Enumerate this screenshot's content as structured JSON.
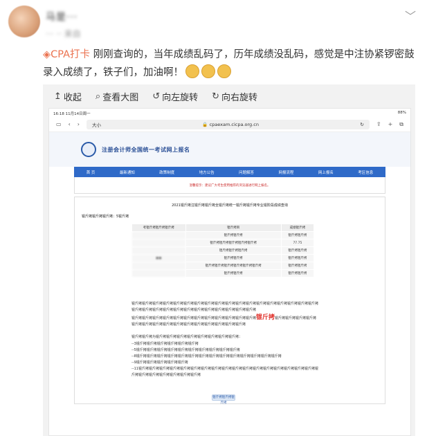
{
  "post": {
    "username": "马是···",
    "meta": "··· ·· 来自",
    "topic": "CPA打卡",
    "body": " 刚刚查询的，当年成绩乱码了，历年成绩没乱码，感觉是中注协紧锣密鼓录入成绩了，铁子们，加油啊！",
    "emoji_count": 3
  },
  "toolbar": {
    "collapse": "收起",
    "view_large": "查看大图",
    "rotate_left": "向左旋转",
    "rotate_right": "向右旋转"
  },
  "screenshot": {
    "status_time": "16:18  11月14日周一",
    "status_battery": "88%",
    "browser_tab": "大小",
    "url": "cpaexam.cicpa.org.cn",
    "site_title": "注册会计师全国统一考试网上报名",
    "nav": [
      "首 页",
      "最新通知",
      "政策制度",
      "地方公告",
      "问题解答",
      "网报流程",
      "网上报名",
      "考区信息"
    ],
    "notice": "温馨提示：建议广大考生使用推荐的浏览器进行网上报名。",
    "report_title": "2021锟斤拷注锟斤拷锟斤拷全锟斤拷统一锟斤拷锟斤拷专业锟阶段成绩查询",
    "report_name": "锟斤拷锟斤拷锟斤拷：5锟斤拷",
    "table_headers": [
      "考锟斤拷锟斤拷锟斤拷",
      "锟斤拷目",
      "成绩锟斤拷"
    ],
    "table_rows": [
      {
        "subject": "锟斤拷锟斤拷",
        "score": "锟斤拷锟斤拷"
      },
      {
        "subject": "锟斤拷锟斤拷锟斤拷锟斤拷锟斤拷",
        "score": "77.75"
      },
      {
        "subject": "锟斤拷锟斤拷锟斤拷",
        "score": "锟斤拷锟斤拷"
      },
      {
        "subject": "锟斤拷锟斤拷",
        "score": "锟斤拷锟斤拷"
      },
      {
        "subject": "锟斤拷锟斤拷锟斤拷锟斤拷锟斤拷锟斤拷",
        "score": "锟斤拷锟斤拷"
      },
      {
        "subject": "锟斤拷锟斤拷",
        "score": "锟斤拷锟斤拷"
      }
    ],
    "para1": "锟斤拷锟斤拷锟斤拷锟斤拷锟斤拷锟斤拷锟斤拷锟斤拷锟斤拷锟斤拷锟斤拷锟斤拷锟斤拷锟斤拷锟斤拷锟斤拷锟斤拷锟斤拷锟斤拷锟斤拷锟斤拷锟斤拷锟斤拷锟斤拷锟斤拷锟斤拷锟斤拷锟斤拷锟斤拷锟斤拷",
    "para2_a": "锟斤拷锟斤拷锟斤拷锟斤拷锟斤拷锟斤拷锟斤拷锟斤拷锟斤拷锟斤拷锟斤拷锟斤拷",
    "para2_red": "锟斤拷",
    "para2_b": "锟斤拷锟斤拷锟斤拷锟斤拷锟斤拷锟斤拷锟斤拷锟斤拷锟斤拷锟斤拷锟斤拷锟斤拷锟斤拷锟斤拷锟斤拷",
    "para3": "锟斤拷锟斤拷为锟斤拷锟斤拷锟斤拷锟斤拷锟斤拷锟斤拷锟斤拷锟斤拷：",
    "list": [
      "--3锟斤拷锟斤拷锟斤拷锟斤拷锟斤拷锟斤拷",
      "--5锟斤拷锟斤拷锟斤拷锟斤拷锟斤拷锟斤拷锟斤拷锟斤拷锟斤拷锟斤拷",
      "--8锟斤拷锟斤拷锟斤拷锟斤拷锟斤拷锟斤拷锟斤拷锟斤拷锟斤拷锟斤拷锟斤拷锟斤拷锟斤拷锟斤拷",
      "--9锟斤拷锟斤拷锟斤拷锟斤拷锟斤拷",
      "--11锟斤拷锟斤拷锟斤拷锟斤拷锟斤拷锟斤拷锟斤拷锟斤拷锟斤拷锟斤拷锟斤拷锟斤拷锟斤拷锟斤拷锟斤拷锟斤拷锟斤拷锟斤拷锟斤拷锟斤拷锟斤拷锟斤拷锟斤拷锟斤拷"
    ],
    "print_button": "锟斤拷锟斤拷锟斤拷"
  }
}
